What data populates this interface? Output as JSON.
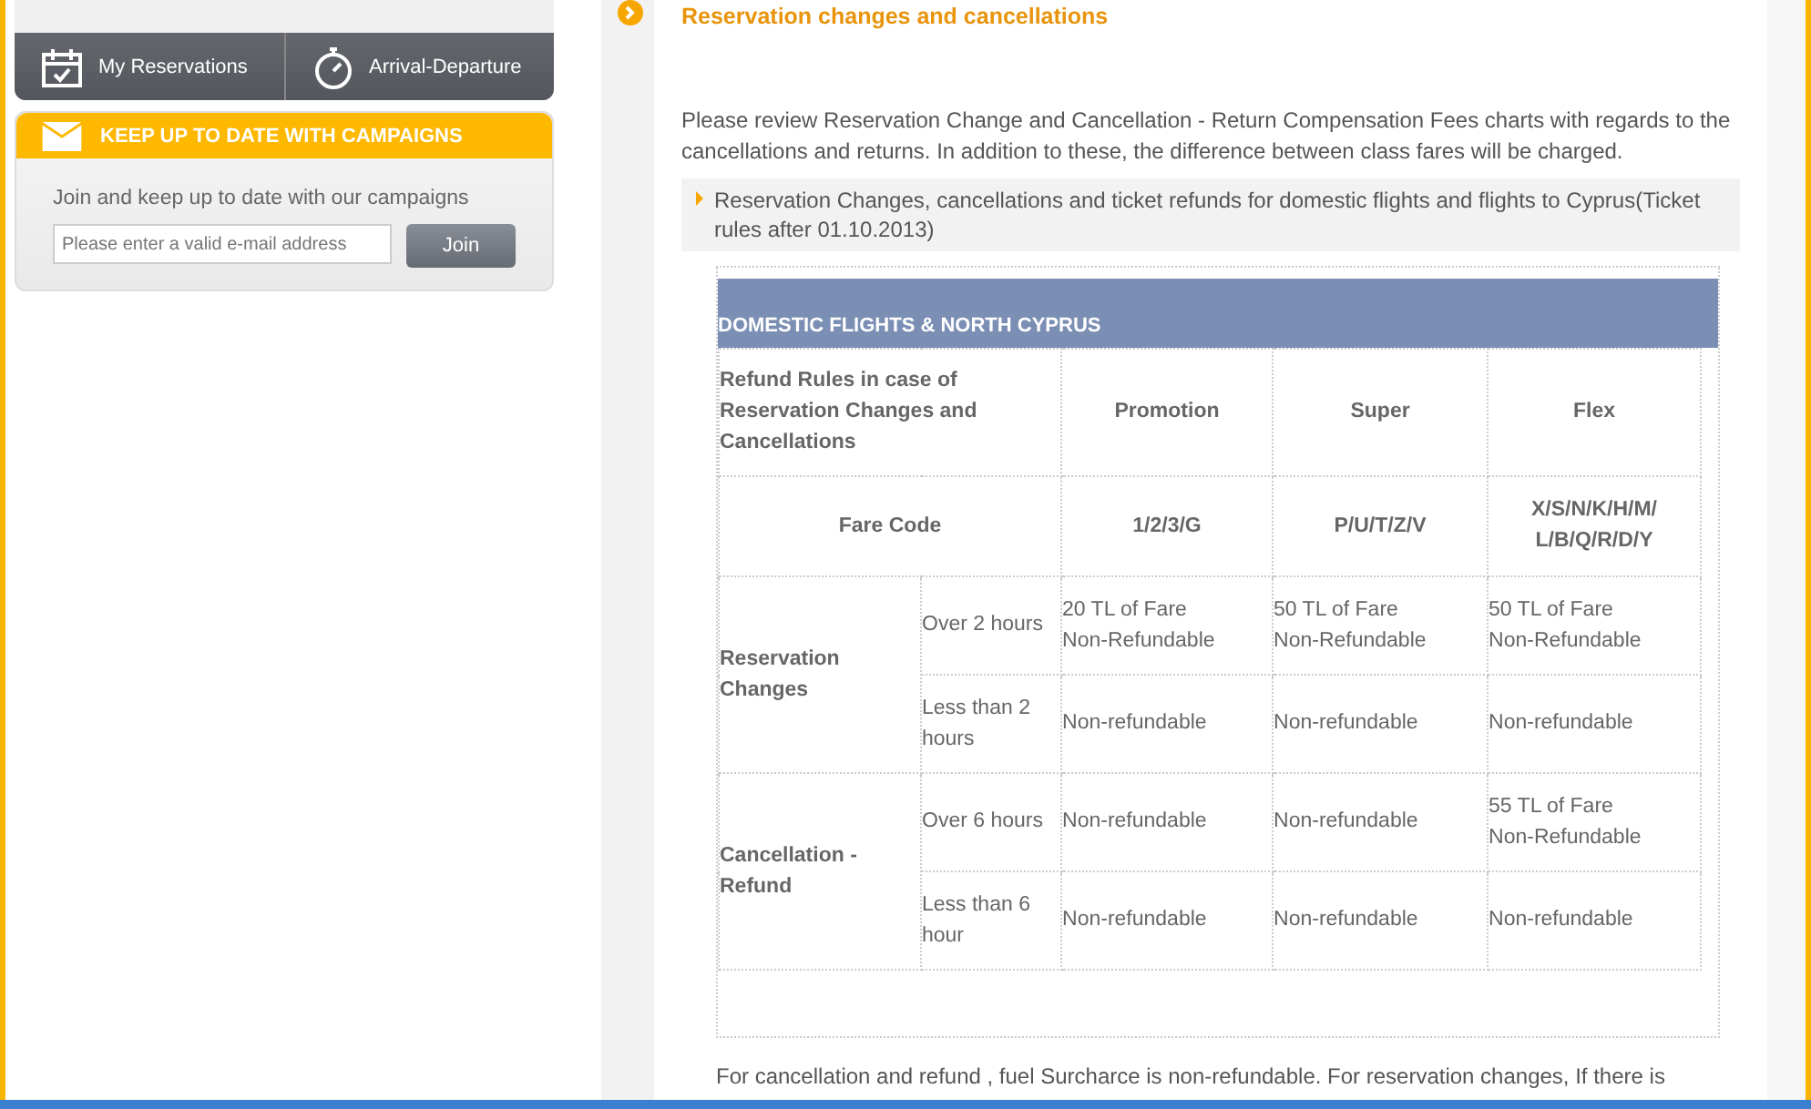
{
  "sidebar": {
    "quick_links": [
      {
        "label": "My Reservations"
      },
      {
        "label": "Arrival-Departure"
      }
    ],
    "campaign": {
      "title": "KEEP UP TO DATE WITH CAMPAIGNS",
      "text": "Join and keep up to date with our campaigns",
      "email": {
        "placeholder": "Please enter a valid e-mail address"
      },
      "button": "Join"
    }
  },
  "main": {
    "title": "Reservation changes and cancellations",
    "intro": "Please review Reservation Change and Cancellation - Return Compensation Fees charts with regards to the cancellations and returns. In addition to these, the difference between class fares will be charged.",
    "rule_note": "Reservation Changes, cancellations and ticket refunds for domestic flights and flights to Cyprus(Ticket rules after 01.10.2013)",
    "table": {
      "title": "DOMESTIC FLIGHTS & NORTH CYPRUS",
      "header_label": "Refund Rules in case of Reservation Changes and Cancellations",
      "columns": [
        "Promotion",
        "Super",
        "Flex"
      ],
      "fare_code": {
        "label": "Fare Code",
        "values": [
          "1/2/3/G",
          "P/U/T/Z/V",
          "X/S/N/K/H/M/\nL/B/Q/R/D/Y"
        ]
      },
      "groups": [
        {
          "label": "Reservation Changes",
          "rows": [
            {
              "condition": "Over 2 hours",
              "values": [
                "20 TL of Fare\nNon-Refundable",
                "50 TL of Fare\nNon-Refundable",
                "50 TL of Fare\nNon-Refundable"
              ]
            },
            {
              "condition": "Less than 2 hours",
              "values": [
                "Non-refundable",
                "Non-refundable",
                "Non-refundable"
              ]
            }
          ]
        },
        {
          "label": "Cancellation - Refund",
          "rows": [
            {
              "condition": "Over 6 hours",
              "values": [
                "Non-refundable",
                "Non-refundable",
                "55 TL of Fare\nNon-Refundable"
              ]
            },
            {
              "condition": "Less than 6 hour",
              "values": [
                "Non-refundable",
                "Non-refundable",
                "Non-refundable"
              ]
            }
          ]
        }
      ]
    },
    "footer_text": "For cancellation and refund , fuel Surcharce is non-refundable. For reservation changes, If there is"
  }
}
